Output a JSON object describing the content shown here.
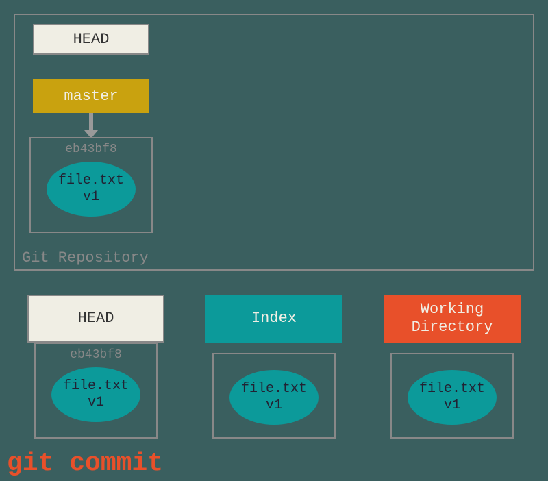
{
  "repo": {
    "label": "Git Repository",
    "head": "HEAD",
    "branch": "master",
    "commit": {
      "hash": "eb43bf8",
      "file": "file.txt",
      "version": "v1"
    }
  },
  "columns": {
    "head": {
      "label": "HEAD",
      "hash": "eb43bf8",
      "file": "file.txt",
      "version": "v1"
    },
    "index": {
      "label": "Index",
      "file": "file.txt",
      "version": "v1"
    },
    "wd": {
      "label": "Working Directory",
      "file": "file.txt",
      "version": "v1"
    }
  },
  "command": "git commit"
}
